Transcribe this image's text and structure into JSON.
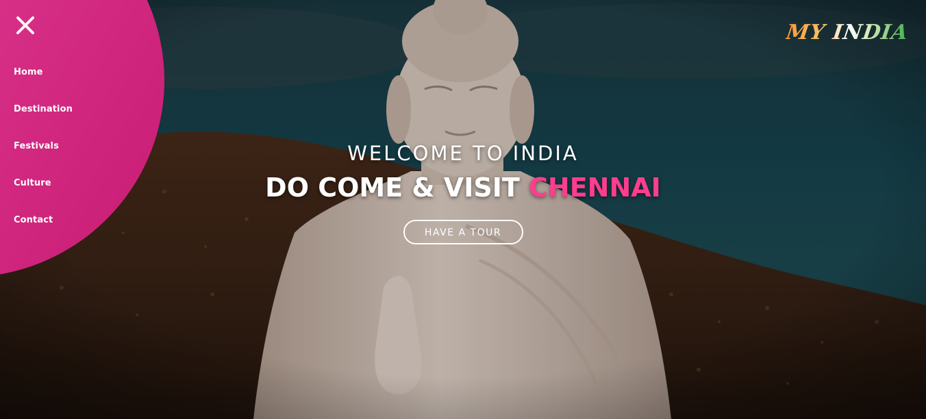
{
  "nav": {
    "close_icon": "close-icon",
    "items": [
      {
        "label": "Home"
      },
      {
        "label": "Destination"
      },
      {
        "label": "Festivals"
      },
      {
        "label": "Culture"
      },
      {
        "label": "Contact"
      }
    ],
    "menu_color": "#d92f88"
  },
  "brand": {
    "logo_text": "MY INDIA"
  },
  "hero": {
    "welcome": "WELCOME TO INDIA",
    "headline_prefix": "DO COME & VISIT",
    "headline_accent": "CHENNAI",
    "accent_color": "#ff3d8f",
    "cta_label": "HAVE A TOUR",
    "background_image": "buddha-statue-on-hill"
  }
}
